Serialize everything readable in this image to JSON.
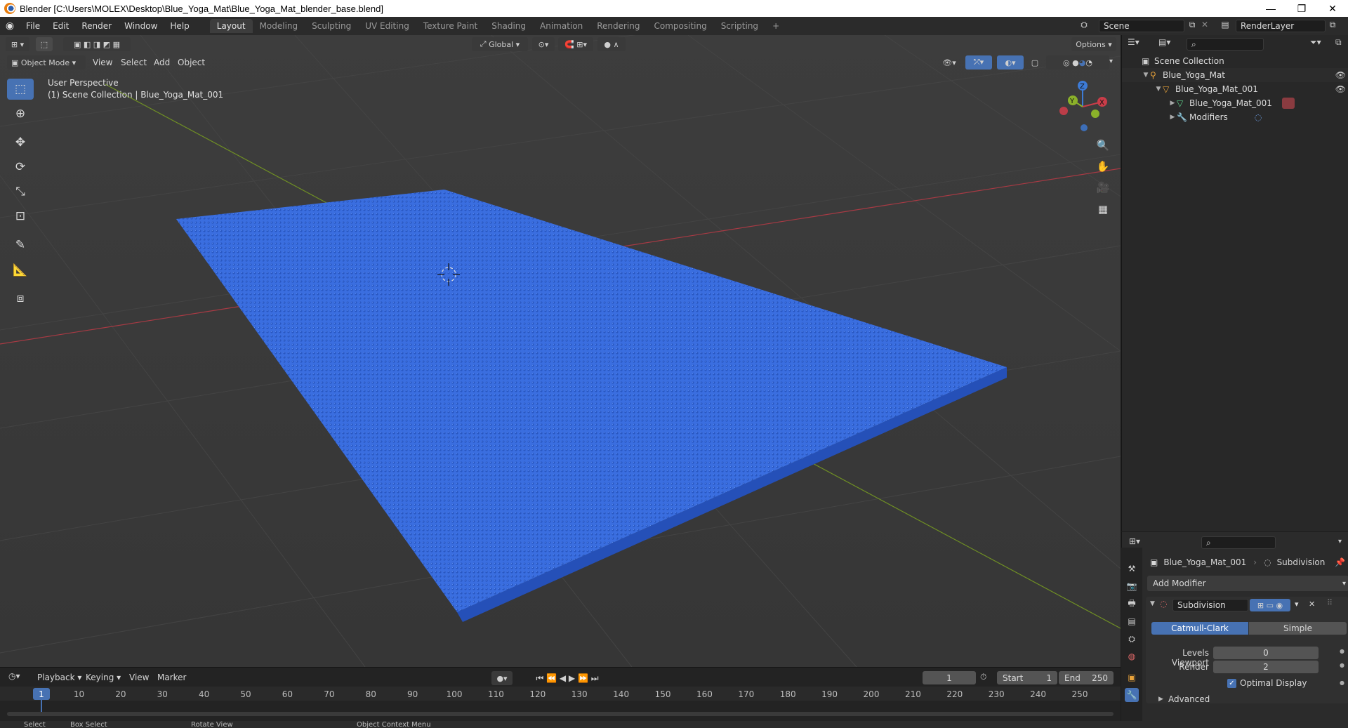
{
  "window": {
    "title": "Blender [C:\\Users\\MOLEX\\Desktop\\Blue_Yoga_Mat\\Blue_Yoga_Mat_blender_base.blend]",
    "minimize": "—",
    "restore": "❐",
    "close": "✕"
  },
  "menu": [
    "File",
    "Edit",
    "Render",
    "Window",
    "Help"
  ],
  "workspaces": [
    "Layout",
    "Modeling",
    "Sculpting",
    "UV Editing",
    "Texture Paint",
    "Shading",
    "Animation",
    "Rendering",
    "Compositing",
    "Scripting"
  ],
  "add_workspace": "+",
  "scene": {
    "name": "Scene",
    "layer": "RenderLayer"
  },
  "viewport_header": {
    "transform_orientation": "Global",
    "options": "Options",
    "mode": "Object Mode",
    "menus": [
      "View",
      "Select",
      "Add",
      "Object"
    ]
  },
  "viewport": {
    "perspective": "User Perspective",
    "collection_info": "(1) Scene Collection | Blue_Yoga_Mat_001"
  },
  "gizmo": {
    "z": "Z",
    "y": "Y",
    "x": "X"
  },
  "outliner": {
    "root": "Scene Collection",
    "rows": [
      "Blue_Yoga_Mat",
      "Blue_Yoga_Mat_001",
      "Blue_Yoga_Mat_001",
      "Modifiers"
    ]
  },
  "properties": {
    "object_name": "Blue_Yoga_Mat_001",
    "modifier_context": "Subdivision",
    "add_modifier": "Add Modifier",
    "modifier_name": "Subdivision",
    "algorithm_options": [
      "Catmull-Clark",
      "Simple"
    ],
    "levels_viewport_label": "Levels Viewport",
    "levels_viewport_value": "0",
    "render_label": "Render",
    "render_value": "2",
    "optimal_display_label": "Optimal Display",
    "optimal_display_checked": true,
    "advanced_label": "Advanced"
  },
  "timeline": {
    "menus": [
      "Playback",
      "Keying",
      "View",
      "Marker"
    ],
    "current_frame": "1",
    "start_label": "Start",
    "start_value": "1",
    "end_label": "End",
    "end_value": "250",
    "ticks": [
      "1",
      "10",
      "20",
      "30",
      "40",
      "50",
      "60",
      "70",
      "80",
      "90",
      "100",
      "110",
      "120",
      "130",
      "140",
      "150",
      "160",
      "170",
      "180",
      "190",
      "200",
      "210",
      "220",
      "230",
      "240",
      "250"
    ]
  },
  "statusbar": [
    "Select",
    "Box Select",
    "Rotate View",
    "Object Context Menu"
  ],
  "colors": {
    "accent": "#4772b3",
    "mat_blue": "#3a6ee0",
    "x_axis": "#c93d49",
    "y_axis": "#8bb12a",
    "z_axis": "#3d7bd6"
  }
}
